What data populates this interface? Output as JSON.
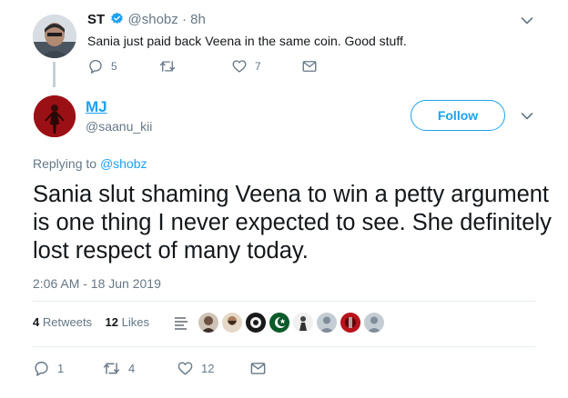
{
  "parent_tweet": {
    "name": "ST",
    "handle": "@shobz",
    "time": "· 8h",
    "text": "Sania just paid back Veena in the same coin. Good stuff.",
    "replies": "5",
    "retweets": "",
    "likes": "7"
  },
  "main_tweet": {
    "name": "MJ",
    "handle": "@saanu_kii",
    "follow_label": "Follow",
    "replying_prefix": "Replying to",
    "replying_to": "@shobz",
    "text": "Sania slut shaming Veena to win a petty argument is one thing I never expected to see. She definitely lost respect of many today.",
    "timestamp": "2:06 AM - 18 Jun 2019",
    "retweets_count": "4",
    "retweets_label": "Retweets",
    "likes_count": "12",
    "likes_label": "Likes",
    "replies": "1",
    "retweets": "4",
    "likes": "12"
  },
  "icons": {
    "reply": "reply-icon",
    "retweet": "retweet-icon",
    "like": "heart-icon",
    "message": "envelope-icon",
    "verified": "verified-badge-icon",
    "menu": "chevron-down-icon"
  },
  "colors": {
    "accent": "#1da1f2",
    "muted": "#657786",
    "text": "#14171a",
    "divider": "#e6ecf0"
  }
}
